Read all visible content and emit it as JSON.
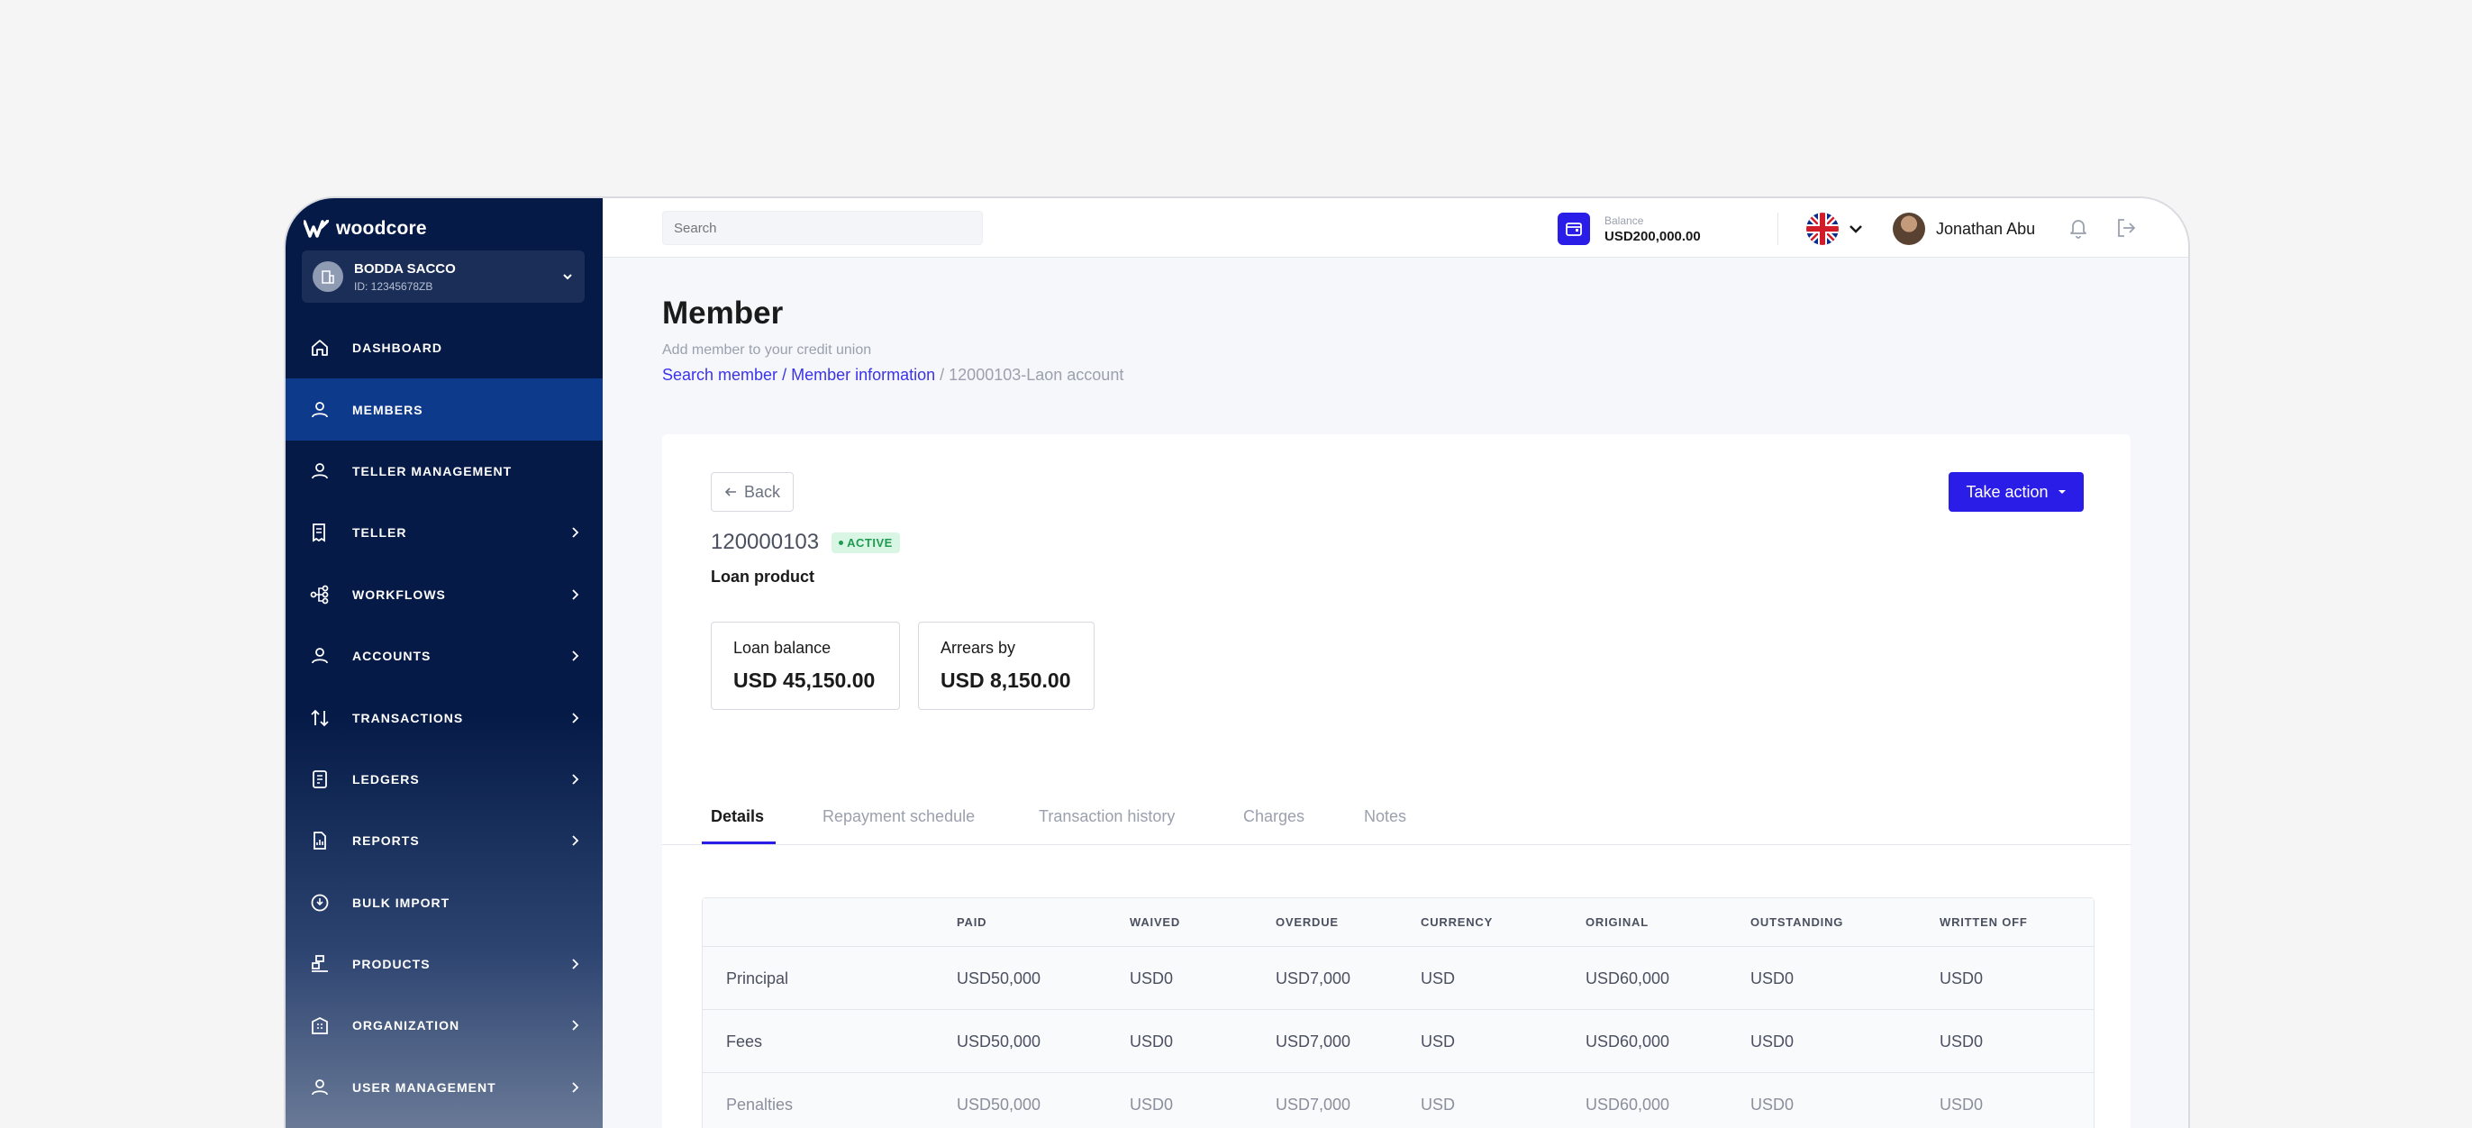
{
  "brand": {
    "name": "woodcore"
  },
  "org": {
    "name": "BODDA SACCO",
    "id": "ID: 12345678ZB"
  },
  "sidebar": {
    "items": [
      {
        "label": "DASHBOARD",
        "icon": "home-icon",
        "chevron": false
      },
      {
        "label": "MEMBERS",
        "icon": "user-icon",
        "chevron": false,
        "active": true
      },
      {
        "label": "TELLER MANAGEMENT",
        "icon": "user-icon",
        "chevron": false
      },
      {
        "label": "TELLER",
        "icon": "receipt-icon",
        "chevron": true
      },
      {
        "label": "WORKFLOWS",
        "icon": "workflow-icon",
        "chevron": true
      },
      {
        "label": "ACCOUNTS",
        "icon": "user-icon",
        "chevron": true
      },
      {
        "label": "TRANSACTIONS",
        "icon": "arrows-updown-icon",
        "chevron": true
      },
      {
        "label": "LEDGERS",
        "icon": "ledger-icon",
        "chevron": true
      },
      {
        "label": "REPORTS",
        "icon": "report-icon",
        "chevron": true
      },
      {
        "label": "BULK IMPORT",
        "icon": "import-icon",
        "chevron": false
      },
      {
        "label": "PRODUCTS",
        "icon": "products-icon",
        "chevron": true
      },
      {
        "label": "ORGANIZATION",
        "icon": "building-icon",
        "chevron": true
      },
      {
        "label": "USER MANAGEMENT",
        "icon": "user-icon",
        "chevron": true
      }
    ]
  },
  "topbar": {
    "search_placeholder": "Search",
    "balance_label": "Balance",
    "balance_value": "USD200,000.00",
    "user_name": "Jonathan Abu"
  },
  "page": {
    "title": "Member",
    "subtitle": "Add member to your credit union",
    "breadcrumb": {
      "link1": "Search member",
      "link2": "/ Member information",
      "current": "/ 12000103-Laon account"
    }
  },
  "account": {
    "back_label": "Back",
    "action_label": "Take action",
    "number": "120000103",
    "status": "ACTIVE",
    "product": "Loan product",
    "loan_balance_label": "Loan balance",
    "loan_balance_value": "USD 45,150.00",
    "arrears_label": "Arrears by",
    "arrears_value": "USD 8,150.00"
  },
  "tabs": [
    "Details",
    "Repayment schedule",
    "Transaction history",
    "Charges",
    "Notes"
  ],
  "table": {
    "headers": [
      "",
      "PAID",
      "WAIVED",
      "OVERDUE",
      "CURRENCY",
      "ORIGINAL",
      "OUTSTANDING",
      "WRITTEN OFF"
    ],
    "rows": [
      [
        "Principal",
        "USD50,000",
        "USD0",
        "USD7,000",
        "USD",
        "USD60,000",
        "USD0",
        "USD0"
      ],
      [
        "Fees",
        "USD50,000",
        "USD0",
        "USD7,000",
        "USD",
        "USD60,000",
        "USD0",
        "USD0"
      ],
      [
        "Penalties",
        "USD50,000",
        "USD0",
        "USD7,000",
        "USD",
        "USD60,000",
        "USD0",
        "USD0"
      ]
    ]
  },
  "colors": {
    "accent": "#2a1de8",
    "sidebar": "#051a46",
    "active": "#0e3a8c",
    "success": "#1e9b50"
  }
}
